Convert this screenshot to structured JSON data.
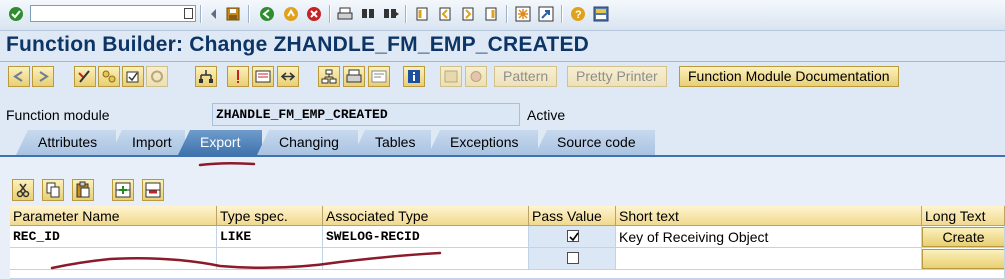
{
  "system_toolbar": {
    "command_field": {
      "value": ""
    },
    "icons": [
      "enter-icon",
      "command-history-icon",
      "back-arrow-icon",
      "save-icon",
      "back-icon",
      "exit-icon",
      "cancel-icon",
      "print-icon",
      "find-icon",
      "find-next-icon",
      "first-page-icon",
      "previous-page-icon",
      "next-page-icon",
      "last-page-icon",
      "new-session-icon",
      "shortcut-icon",
      "help-icon",
      "layout-icon"
    ]
  },
  "title": "Function Builder: Change ZHANDLE_FM_EMP_CREATED",
  "app_toolbar": {
    "pattern_label": "Pattern",
    "pretty_printer_label": "Pretty Printer",
    "fm_doc_label": "Function Module Documentation"
  },
  "function_module": {
    "label": "Function module",
    "value": "ZHANDLE_FM_EMP_CREATED",
    "status": "Active"
  },
  "tabs": [
    {
      "label": "Attributes"
    },
    {
      "label": "Import"
    },
    {
      "label": "Export"
    },
    {
      "label": "Changing"
    },
    {
      "label": "Tables"
    },
    {
      "label": "Exceptions"
    },
    {
      "label": "Source code"
    }
  ],
  "active_tab": "Export",
  "table": {
    "headers": {
      "param": "Parameter Name",
      "type": "Type spec.",
      "assoc": "Associated Type",
      "pass": "Pass Value",
      "short": "Short text",
      "long": "Long Text"
    },
    "rows": [
      {
        "param": "REC_ID",
        "type": "LIKE",
        "assoc": "SWELOG-RECID",
        "pass_value": true,
        "short": "Key of Receiving Object",
        "long": "Create"
      },
      {
        "param": "",
        "type": "",
        "assoc": "",
        "pass_value": false,
        "short": "",
        "long": ""
      }
    ]
  },
  "colors": {
    "accent": "#0c3566",
    "active_tab": "#3f73ad",
    "annotation": "#8b1a2b"
  }
}
